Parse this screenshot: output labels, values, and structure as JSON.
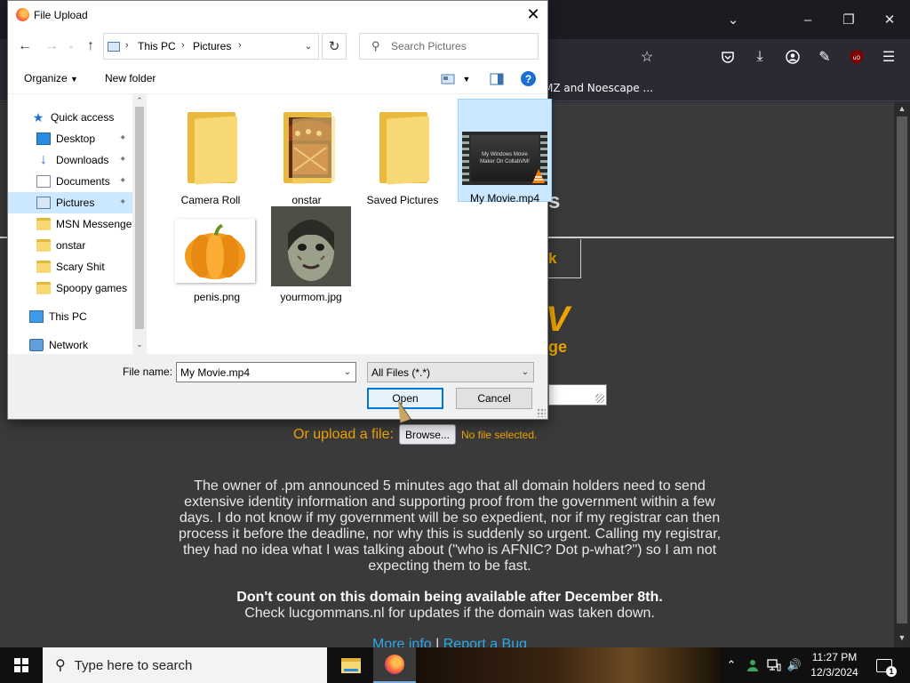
{
  "browser": {
    "bookmark_fragment": "MZ and Noescape ...",
    "page": {
      "heading_fragment_s": "s",
      "heading_fragment_k": "k",
      "big_letter_fragment": "V",
      "subheading_fragment": "ge",
      "upload_label": "Or upload a file:",
      "browse_label": "Browse...",
      "no_file_text": "No file selected.",
      "notice_text": "The owner of .pm announced 5 minutes ago that all domain holders need to send extensive identity information and supporting proof from the government within a few days. I do not know if my government will be so expedient, nor if my registrar can then process it before the deadline, nor why this is suddenly so urgent. Calling my registrar, they had no idea what I was talking about (\"who is AFNIC? Dot p-what?\") so I am not expecting them to be fast.",
      "notice_bold": "Don't count on this domain being available after December 8th.",
      "notice_check": "Check lucgommans.nl for updates if the domain was taken down.",
      "link_more_info": "More info",
      "link_separator": "|",
      "link_report_bug": "Report a Bug"
    }
  },
  "dialog": {
    "title": "File Upload",
    "address": {
      "segments": [
        "This PC",
        "Pictures"
      ]
    },
    "search_placeholder": "Search Pictures",
    "toolbar": {
      "organize_label": "Organize",
      "new_folder_label": "New folder"
    },
    "nav_items": [
      {
        "label": "Quick access",
        "icon": "star-icon",
        "pinned": false
      },
      {
        "label": "Desktop",
        "icon": "desktop-icon",
        "pinned": true
      },
      {
        "label": "Downloads",
        "icon": "download-icon",
        "pinned": true
      },
      {
        "label": "Documents",
        "icon": "documents-icon",
        "pinned": true
      },
      {
        "label": "Pictures",
        "icon": "pictures-icon",
        "pinned": true,
        "selected": true
      },
      {
        "label": "MSN Messenger",
        "icon": "folder-icon",
        "pinned": false
      },
      {
        "label": "onstar",
        "icon": "folder-icon",
        "pinned": false
      },
      {
        "label": "Scary Shit",
        "icon": "folder-icon",
        "pinned": false
      },
      {
        "label": "Spoopy games",
        "icon": "folder-icon",
        "pinned": false
      },
      {
        "label": "This PC",
        "icon": "computer-icon",
        "pinned": false
      },
      {
        "label": "Network",
        "icon": "network-icon",
        "pinned": false
      }
    ],
    "files": [
      {
        "name": "Camera Roll",
        "type": "folder"
      },
      {
        "name": "onstar",
        "type": "folder-with-image"
      },
      {
        "name": "Saved Pictures",
        "type": "folder"
      },
      {
        "name": "My Movie.mp4",
        "type": "video",
        "selected": true,
        "thumb_text": "My Windows Movie Maker On CollabVM!"
      },
      {
        "name": "penis.png",
        "type": "image-pumpkin"
      },
      {
        "name": "yourmom.jpg",
        "type": "image-face"
      }
    ],
    "file_name_label": "File name:",
    "file_name_value": "My Movie.mp4",
    "file_type_value": "All Files (*.*)",
    "open_label": "Open",
    "cancel_label": "Cancel"
  },
  "taskbar": {
    "search_placeholder": "Type here to search",
    "time": "11:27 PM",
    "date": "12/3/2024",
    "notification_count": "1"
  }
}
